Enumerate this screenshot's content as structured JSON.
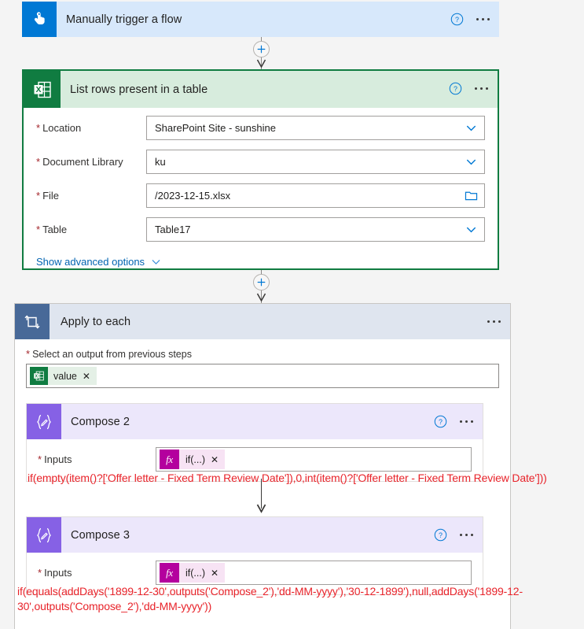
{
  "colors": {
    "trigger_header": "#d7e8fb",
    "trigger_icon": "#0078d4",
    "excel_header": "#d7ecdd",
    "excel_icon": "#107c41",
    "excel_border": "#107c41",
    "loop_header": "#dfe5ef",
    "loop_icon": "#486998",
    "compose_header": "#ece7fb",
    "compose_icon": "#8661e5",
    "expression_text": "#e8232a",
    "link_blue": "#0063b1",
    "required_asterisk": "#a4262c",
    "fx_badge": "#b4009e",
    "canvas_background": "#f4f4f4"
  },
  "trigger": {
    "title": "Manually trigger a flow",
    "icon": "tap-hand-icon",
    "help_icon": "help-circle-icon",
    "menu_icon": "ellipsis-icon"
  },
  "excel_action": {
    "title": "List rows present in a table",
    "icon": "excel-table-icon",
    "help_icon": "help-circle-icon",
    "menu_icon": "ellipsis-icon",
    "fields": [
      {
        "label": "Location",
        "required": true,
        "value": "SharePoint Site - sunshine",
        "control": "dropdown",
        "control_icon": "chevron-down-icon"
      },
      {
        "label": "Document Library",
        "required": true,
        "value": "ku",
        "control": "dropdown",
        "control_icon": "chevron-down-icon"
      },
      {
        "label": "File",
        "required": true,
        "value": "/2023-12-15.xlsx",
        "control": "file-picker",
        "control_icon": "folder-icon"
      },
      {
        "label": "Table",
        "required": true,
        "value": "Table17",
        "control": "dropdown",
        "control_icon": "chevron-down-icon"
      }
    ],
    "advanced_options_label": "Show advanced options",
    "advanced_options_icon": "chevron-down-icon"
  },
  "loop": {
    "title": "Apply to each",
    "icon": "loop-repeat-icon",
    "menu_icon": "ellipsis-icon",
    "select_output_label": "Select an output from previous steps",
    "select_output_required": true,
    "token": {
      "label": "value",
      "icon": "excel-token-icon",
      "remove_icon": "close-x-icon"
    }
  },
  "compose_2": {
    "title": "Compose 2",
    "icon": "compose-braces-icon",
    "help_icon": "help-circle-icon",
    "menu_icon": "ellipsis-icon",
    "inputs_label": "Inputs",
    "inputs_required": true,
    "token": {
      "badge": "fx",
      "label": "if(...)",
      "remove_icon": "close-x-icon"
    },
    "expression": "if(empty(item()?['Offer letter - Fixed Term Review Date']),0,int(item()?['Offer letter - Fixed Term Review Date']))"
  },
  "compose_3": {
    "title": "Compose 3",
    "icon": "compose-braces-icon",
    "help_icon": "help-circle-icon",
    "menu_icon": "ellipsis-icon",
    "inputs_label": "Inputs",
    "inputs_required": true,
    "token": {
      "badge": "fx",
      "label": "if(...)",
      "remove_icon": "close-x-icon"
    },
    "expression": "if(equals(addDays('1899-12-30',outputs('Compose_2'),'dd-MM-yyyy'),'30-12-1899'),null,addDays('1899-12-30',outputs('Compose_2'),'dd-MM-yyyy'))"
  },
  "connectors": {
    "add_step_label": "+"
  }
}
